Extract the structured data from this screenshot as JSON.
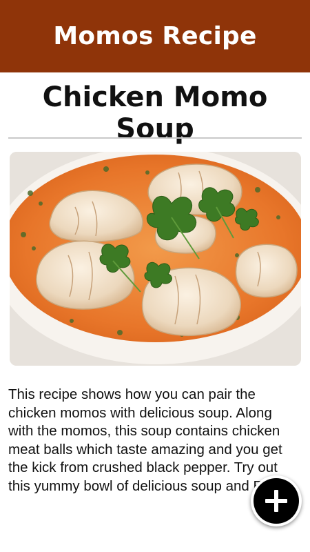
{
  "app_bar": {
    "title": "Momos Recipe",
    "color": "#8f3409"
  },
  "recipe": {
    "title": "Chicken Momo Soup",
    "image_icon": "momo-soup-photo",
    "description": "This recipe shows how you can pair the chicken momos with delicious soup. Along with the momos, this soup contains chicken meat balls which taste amazing and you get the kick from crushed black pepper. Try out this yummy bowl of delicious soup and Enjoy!"
  },
  "fab": {
    "icon": "plus-icon"
  }
}
